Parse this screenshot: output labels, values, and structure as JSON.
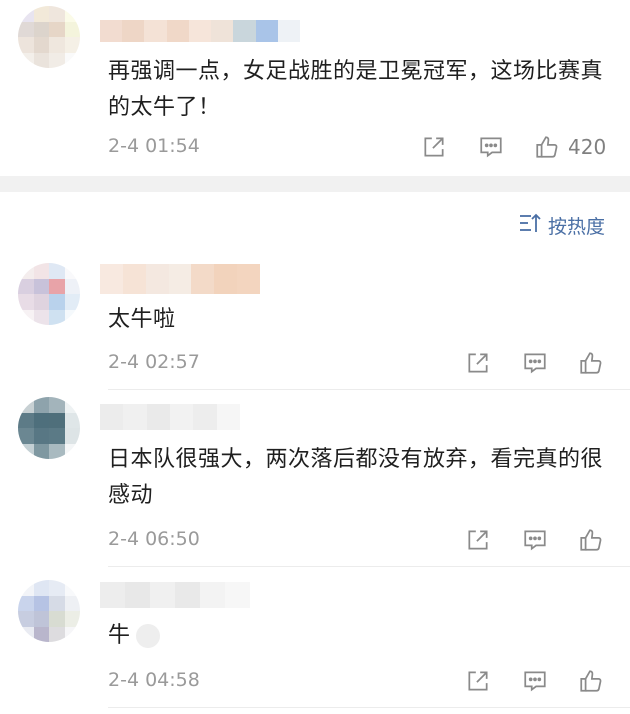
{
  "sort": {
    "label": "按热度"
  },
  "comments": [
    {
      "text": "再强调一点，女足战胜的是卫冕冠军，这场比赛真的太牛了！",
      "time": "2-4 01:54",
      "likes": "420"
    },
    {
      "text": "太牛啦",
      "time": "2-4 02:57",
      "likes": ""
    },
    {
      "text": "日本队很强大，两次落后都没有放弃，看完真的很感动",
      "time": "2-4 06:50",
      "likes": ""
    },
    {
      "text": "牛",
      "time": "2-4 04:58",
      "likes": ""
    }
  ],
  "icons": {
    "share": "share-icon",
    "reply": "comment-icon",
    "like": "thumbs-up-icon",
    "sort": "sort-icon"
  },
  "colors": {
    "accent": "#4a6fa5",
    "muted": "#9a9a9a",
    "gap": "#f1f1f1"
  }
}
